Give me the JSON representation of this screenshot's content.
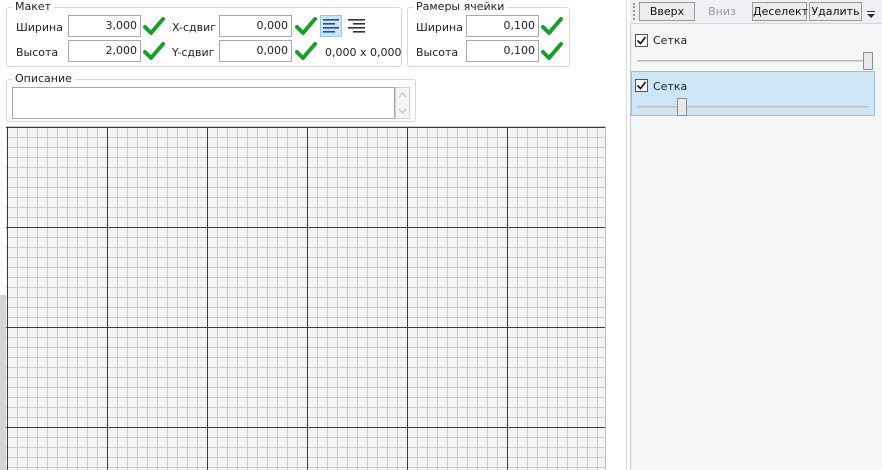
{
  "layout_group": {
    "legend": "Макет",
    "width_label": "Ширина",
    "width_value": "3,000",
    "height_label": "Высота",
    "height_value": "2,000",
    "xshift_label": "X-сдвиг",
    "xshift_value": "0,000",
    "yshift_label": "Y-сдвиг",
    "yshift_value": "0,000",
    "size_readout": "0,000 x 0,000"
  },
  "cell_group": {
    "legend": "Рамеры ячейки",
    "width_label": "Ширина",
    "width_value": "0,100",
    "height_label": "Высота",
    "height_value": "0,100"
  },
  "description": {
    "legend": "Описание",
    "value": ""
  },
  "right_panel": {
    "buttons": {
      "up": "Вверх",
      "down": "Вниз",
      "deselect": "Деселект",
      "delete": "Удалить"
    },
    "layers": [
      {
        "label": "Сетка",
        "checked": true,
        "slider_fraction": 1.0,
        "selected": false
      },
      {
        "label": "Сетка",
        "checked": true,
        "slider_fraction": 0.2,
        "selected": true
      }
    ]
  },
  "icons": {
    "apply": "check-icon",
    "align_left": "align-left-icon",
    "align_right": "align-right-icon"
  },
  "colors": {
    "check_green": "#1a9e2a",
    "selected_row": "#cde6f7",
    "grid_major": "#3a3a3a",
    "grid_minor": "#c9c9c9"
  }
}
